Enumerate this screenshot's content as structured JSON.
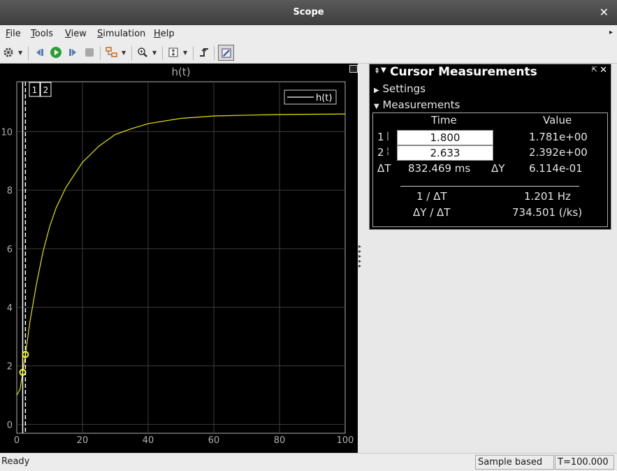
{
  "window": {
    "title": "Scope",
    "close_icon": "close-icon"
  },
  "menu": {
    "items": [
      {
        "accel": "F",
        "rest": "ile"
      },
      {
        "accel": "T",
        "rest": "ools"
      },
      {
        "accel": "V",
        "rest": "iew"
      },
      {
        "accel": "S",
        "rest": "imulation"
      },
      {
        "accel": "H",
        "rest": "elp"
      }
    ]
  },
  "toolbar": {
    "icons": [
      "gear-icon",
      "step-back-icon",
      "run-icon",
      "step-forward-icon",
      "stop-icon",
      "highlight-block-icon",
      "zoom-icon",
      "scale-axes-icon",
      "triggers-icon",
      "cursor-measurements-icon"
    ]
  },
  "plot": {
    "title": "h(t)",
    "legend": "h(t)",
    "cursor_labels": [
      "1",
      "2"
    ]
  },
  "chart_data": {
    "type": "line",
    "title": "h(t)",
    "xlabel": "",
    "ylabel": "",
    "xlim": [
      0,
      100
    ],
    "ylim": [
      -0.3,
      11.7
    ],
    "xticks": [
      0,
      20,
      40,
      60,
      80,
      100
    ],
    "yticks": [
      0,
      2,
      4,
      6,
      8,
      10
    ],
    "grid": true,
    "legend_position": "top-right",
    "series": [
      {
        "name": "h(t)",
        "color": "#e6e600",
        "x": [
          0,
          1,
          1.8,
          2.633,
          4,
          6,
          8,
          10,
          12,
          15,
          20,
          25,
          30,
          35,
          40,
          50,
          60,
          70,
          80,
          90,
          100
        ],
        "y": [
          1.0,
          1.2,
          1.781,
          2.392,
          3.5,
          4.8,
          5.9,
          6.75,
          7.4,
          8.1,
          8.95,
          9.5,
          9.9,
          10.1,
          10.27,
          10.45,
          10.53,
          10.56,
          10.58,
          10.59,
          10.6
        ]
      }
    ],
    "cursors": [
      {
        "label": "1",
        "x": 1.8,
        "y": 1.781
      },
      {
        "label": "2",
        "x": 2.633,
        "y": 2.392
      }
    ]
  },
  "measurements": {
    "panel_title": "Cursor Measurements",
    "settings_label": "Settings",
    "measurements_label": "Measurements",
    "col_time": "Time",
    "col_value": "Value",
    "row1_label": "1",
    "row1_time": "1.800",
    "row1_value": "1.781e+00",
    "row2_label": "2",
    "row2_time": "2.633",
    "row2_value": "2.392e+00",
    "dt_label": "ΔT",
    "dt_value": "832.469 ms",
    "dy_label": "ΔY",
    "dy_value": "6.114e-01",
    "inv_dt_label": "1 / ΔT",
    "inv_dt_value": "1.201 Hz",
    "dydt_label": "ΔY / ΔT",
    "dydt_value": "734.501 (/ks)"
  },
  "status": {
    "ready": "Ready",
    "sample": "Sample based",
    "time": "T=100.000"
  }
}
